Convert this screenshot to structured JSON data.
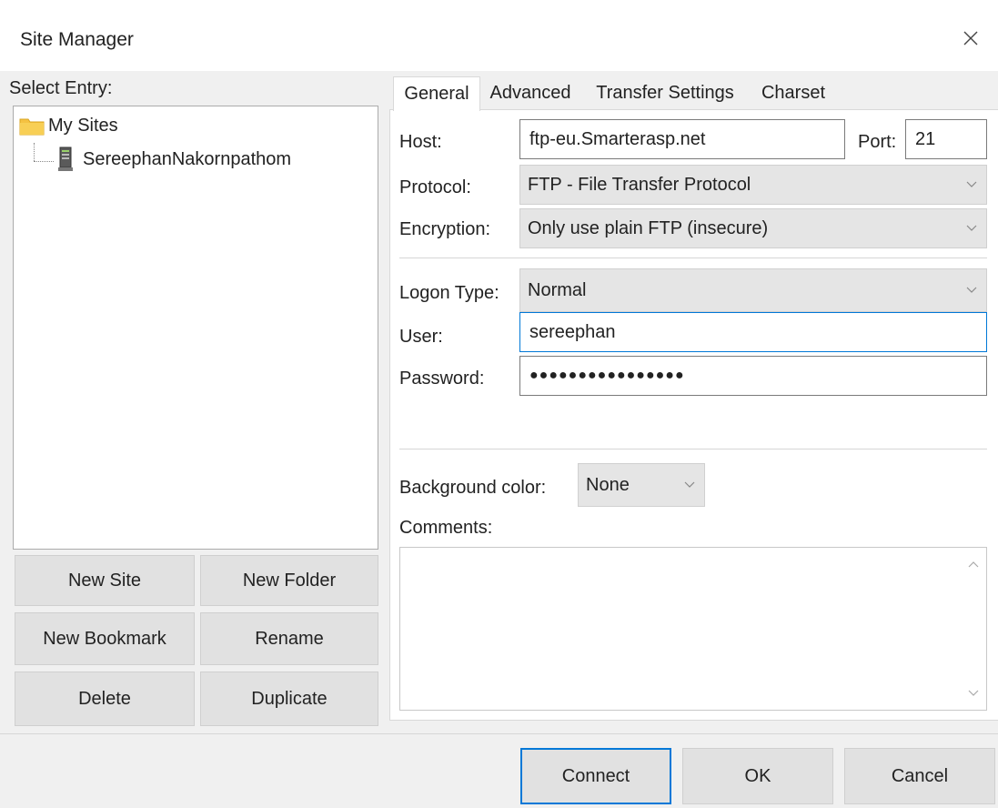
{
  "window": {
    "title": "Site Manager",
    "close_icon": "close-icon"
  },
  "tree": {
    "label": "Select Entry:",
    "root": {
      "label": "My Sites",
      "icon": "folder-icon"
    },
    "children": [
      {
        "label": "SereephanNakornpathom",
        "icon": "server-icon"
      }
    ]
  },
  "left_buttons": {
    "new_site": "New Site",
    "new_folder": "New Folder",
    "new_bookmark": "New Bookmark",
    "rename": "Rename",
    "delete": "Delete",
    "duplicate": "Duplicate"
  },
  "tabs": [
    "General",
    "Advanced",
    "Transfer Settings",
    "Charset"
  ],
  "active_tab": "General",
  "general": {
    "host_label": "Host:",
    "host_value": "ftp-eu.Smarterasp.net",
    "port_label": "Port:",
    "port_value": "21",
    "protocol_label": "Protocol:",
    "protocol_value": "FTP - File Transfer Protocol",
    "encryption_label": "Encryption:",
    "encryption_value": "Only use plain FTP (insecure)",
    "logon_type_label": "Logon Type:",
    "logon_type_value": "Normal",
    "user_label": "User:",
    "user_value": "sereephan",
    "password_label": "Password:",
    "password_value": "●●●●●●●●●●●●●●●●",
    "bg_color_label": "Background color:",
    "bg_color_value": "None",
    "comments_label": "Comments:"
  },
  "footer_buttons": {
    "connect": "Connect",
    "ok": "OK",
    "cancel": "Cancel"
  },
  "colors": {
    "focus_border": "#0078d7",
    "folder": "#f5c242",
    "button_bg": "#e1e1e1"
  }
}
